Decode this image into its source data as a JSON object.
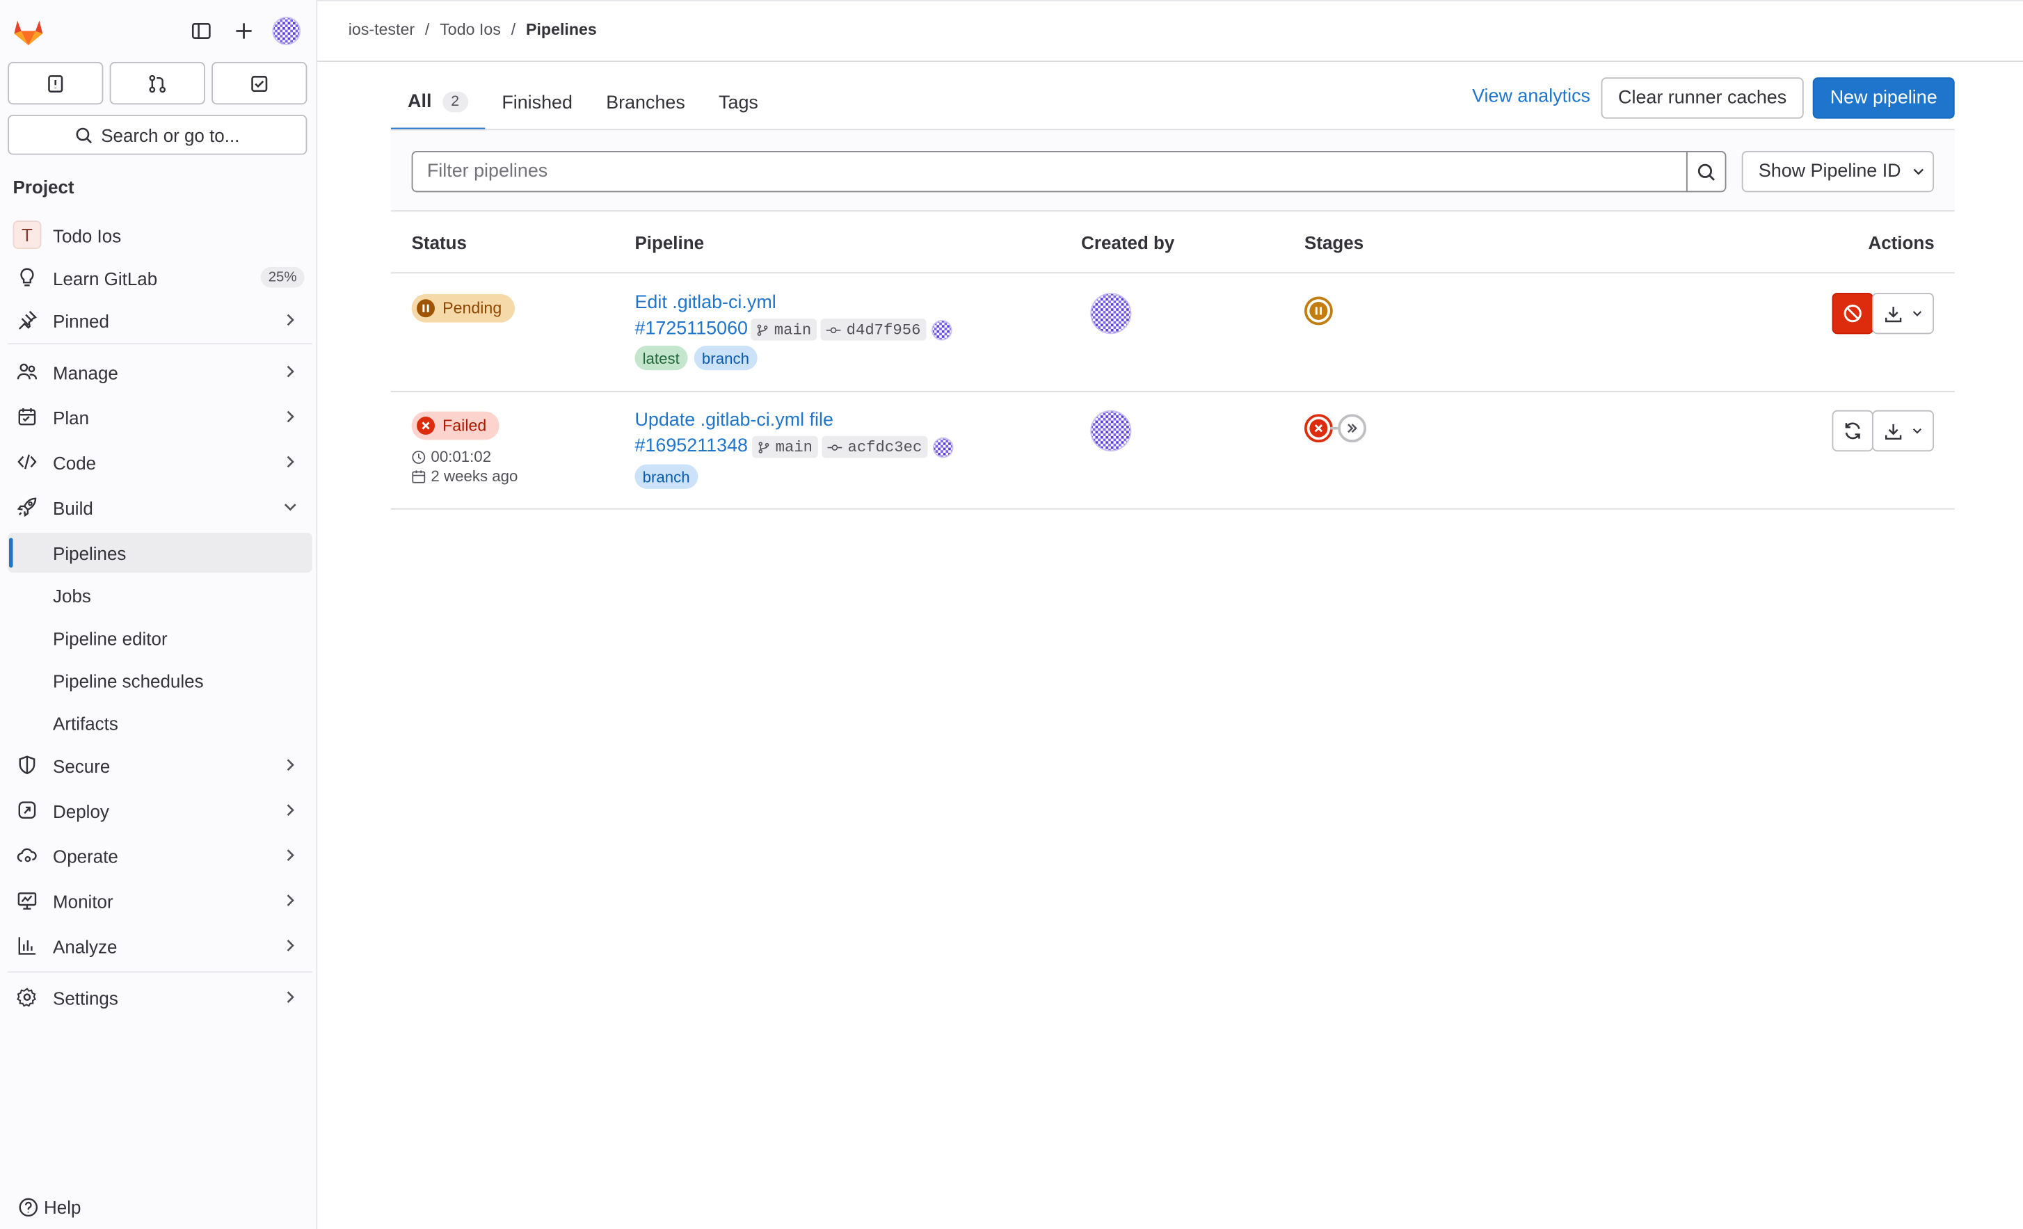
{
  "breadcrumb": {
    "group": "ios-tester",
    "project": "Todo Ios",
    "current": "Pipelines"
  },
  "sidebar": {
    "search_label": "Search or go to...",
    "section_title": "Project",
    "project_initial": "T",
    "project_name": "Todo Ios",
    "learn_label": "Learn GitLab",
    "learn_progress": "25%",
    "pinned": "Pinned",
    "manage": "Manage",
    "plan": "Plan",
    "code": "Code",
    "build": "Build",
    "build_items": [
      "Pipelines",
      "Jobs",
      "Pipeline editor",
      "Pipeline schedules",
      "Artifacts"
    ],
    "secure": "Secure",
    "deploy": "Deploy",
    "operate": "Operate",
    "monitor": "Monitor",
    "analyze": "Analyze",
    "settings": "Settings",
    "help": "Help"
  },
  "tabs": [
    {
      "label": "All",
      "count": "2"
    },
    {
      "label": "Finished"
    },
    {
      "label": "Branches"
    },
    {
      "label": "Tags"
    }
  ],
  "header_actions": {
    "view_analytics": "View analytics",
    "clear_caches": "Clear runner caches",
    "new_pipeline": "New pipeline"
  },
  "filter": {
    "placeholder": "Filter pipelines",
    "show_id": "Show Pipeline ID"
  },
  "table": {
    "columns": [
      "Status",
      "Pipeline",
      "Created by",
      "Stages",
      "Actions"
    ],
    "rows": [
      {
        "status": "Pending",
        "title": "Edit .gitlab-ci.yml",
        "id": "#1725115060",
        "branch": "main",
        "commit": "d4d7f956",
        "tags": [
          "latest",
          "branch"
        ]
      },
      {
        "status": "Failed",
        "duration": "00:01:02",
        "finished": "2 weeks ago",
        "title": "Update .gitlab-ci.yml file",
        "id": "#1695211348",
        "branch": "main",
        "commit": "acfdc3ec",
        "tags": [
          "branch"
        ]
      }
    ]
  },
  "colors": {
    "primary": "#1f75cb",
    "danger": "#dd2b0e",
    "pending": "#c17d10",
    "failed": "#dd2b0e"
  }
}
